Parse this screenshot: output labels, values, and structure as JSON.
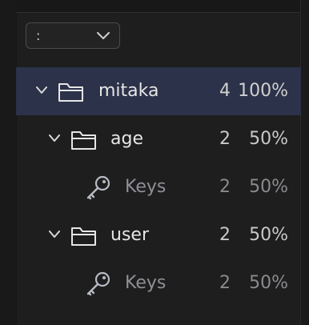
{
  "filter": {
    "value": ":",
    "icon": "chevron-down-icon"
  },
  "tree": {
    "root": {
      "name": "mitaka",
      "count": "4",
      "percent": "100%",
      "icon": "folder-icon"
    },
    "age": {
      "name": "age",
      "count": "2",
      "percent": "50%",
      "icon": "folder-icon"
    },
    "age_keys": {
      "name": "Keys",
      "count": "2",
      "percent": "50%",
      "icon": "key-icon"
    },
    "user": {
      "name": "user",
      "count": "2",
      "percent": "50%",
      "icon": "folder-icon"
    },
    "user_keys": {
      "name": "Keys",
      "count": "2",
      "percent": "50%",
      "icon": "key-icon"
    }
  },
  "colors": {
    "selected_row": "#2b3249",
    "background": "#1e1e1e"
  }
}
